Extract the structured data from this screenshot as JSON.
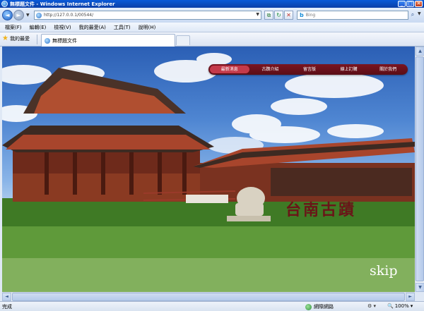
{
  "window": {
    "title": "無標題文件 - Windows Internet Explorer"
  },
  "address_bar": {
    "url": "http://127.0.0.1/00544/"
  },
  "search": {
    "placeholder": "Bing"
  },
  "menu": {
    "items": [
      "檔案(F)",
      "編輯(E)",
      "檢視(V)",
      "我的最愛(A)",
      "工具(T)",
      "說明(H)"
    ]
  },
  "favorites": {
    "label": "我的最愛"
  },
  "tab": {
    "label": "無標題文件"
  },
  "site": {
    "nav": [
      "最新消息",
      "古蹟介紹",
      "留言版",
      "線上訂購",
      "關於我們"
    ],
    "title": "台南古蹟",
    "skip": "skip"
  },
  "status": {
    "text": "完成",
    "zone": "網際網路",
    "zoom": "100%"
  },
  "icons": {
    "back": "back-arrow-icon",
    "forward": "forward-arrow-icon",
    "favorites": "star-icon",
    "zone": "globe-icon"
  }
}
